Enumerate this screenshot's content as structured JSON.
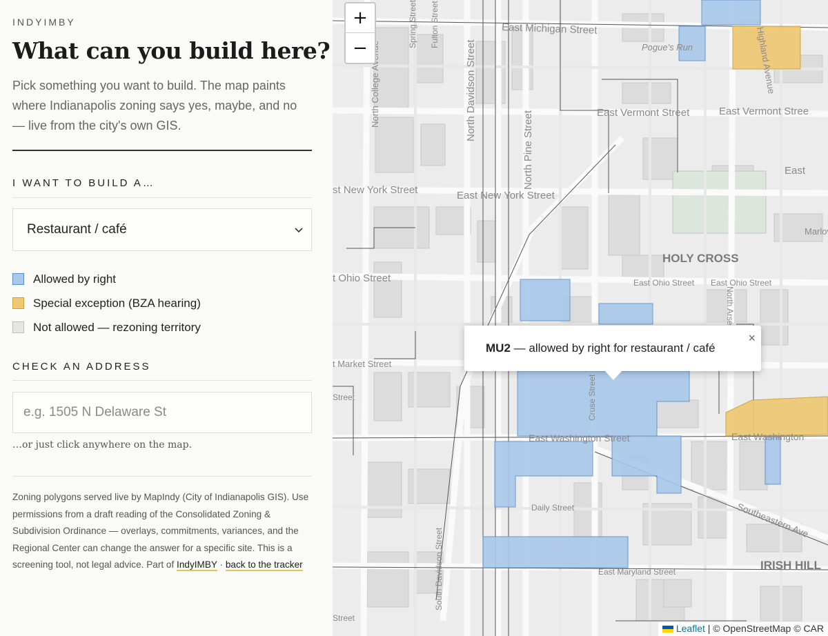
{
  "brand": "INDYIMBY",
  "title": "What can you build here?",
  "intro": "Pick something you want to build. The map paints where Indianapolis zoning says yes, maybe, and no — live from the city's own GIS.",
  "build_section": {
    "label": "I WANT TO BUILD A…",
    "selected": "Restaurant / café"
  },
  "legend": [
    {
      "label": "Allowed by right",
      "color": "#a9c8ea",
      "border": "#5b8fca"
    },
    {
      "label": "Special exception (BZA hearing)",
      "color": "#eec873",
      "border": "#c9a23a"
    },
    {
      "label": "Not allowed — rezoning territory",
      "color": "#e6e6e3",
      "border": "#bdbdbd"
    }
  ],
  "address_section": {
    "label": "CHECK AN ADDRESS",
    "placeholder": "e.g. 1505 N Delaware St",
    "hint": "…or just click anywhere on the map."
  },
  "footer": {
    "text": "Zoning polygons served live by MapIndy (City of Indianapolis GIS). Use permissions from a draft reading of the Consolidated Zoning & Subdivision Ordinance — overlays, commitments, variances, and the Regional Center can change the answer for a specific site. This is a screening tool, not legal advice. Part of",
    "link1": "IndyIMBY",
    "separator": "·",
    "link2": "back to the tracker"
  },
  "map": {
    "zoom_in": "+",
    "zoom_out": "−",
    "popup": {
      "zone": "MU2",
      "text": "— allowed by right for restaurant / café",
      "close": "×"
    },
    "attribution": {
      "leaflet": "Leaflet",
      "rest": "| © OpenStreetMap © CAR"
    },
    "labels": [
      "East Michigan Street",
      "Pogue's Run",
      "East Vermont Street",
      "East Vermont Street",
      "East New York Street",
      "East",
      "HOLY CROSS",
      "Marlov",
      "East Ohio Street",
      "East Ohio Street",
      "East Ohio Street",
      "East Market Street",
      "East Washington Street",
      "East Washington",
      "Daily Street",
      "Southeastern Ave",
      "IRISH HILL",
      "East Maryland Street",
      "North Davidson Street",
      "North Pine Street",
      "North College Avenue",
      "Spring Street",
      "Fulton Street",
      "Cruse Street",
      "South Davidson Street",
      "Highland Avenue",
      "North Arsenal",
      "Ohio Street",
      "Street",
      "Street"
    ]
  }
}
